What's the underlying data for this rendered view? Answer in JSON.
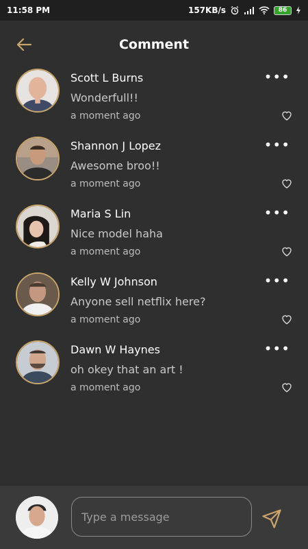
{
  "status": {
    "time": "11:58 PM",
    "speed": "157KB/s",
    "battery": "86"
  },
  "header": {
    "title": "Comment"
  },
  "comments": [
    {
      "name": "Scott L Burns",
      "text": "Wonderfull!!",
      "time": "a moment ago"
    },
    {
      "name": "Shannon J Lopez",
      "text": "Awesome broo!!",
      "time": "a moment ago"
    },
    {
      "name": "Maria S Lin",
      "text": "Nice model haha",
      "time": "a moment ago"
    },
    {
      "name": "Kelly W Johnson",
      "text": "Anyone sell netflix here?",
      "time": "a moment ago"
    },
    {
      "name": "Dawn W Haynes",
      "text": "oh okey that an art !",
      "time": "a moment ago"
    }
  ],
  "composer": {
    "placeholder": "Type a message"
  },
  "colors": {
    "accent": "#c9a46b",
    "background": "#2f2f2f",
    "statusbar": "#1f1f1f",
    "composer": "#3a3a3a"
  },
  "icons": {
    "back": "arrow-left-icon",
    "more": "more-dots-icon",
    "like": "heart-icon",
    "send": "send-icon"
  }
}
